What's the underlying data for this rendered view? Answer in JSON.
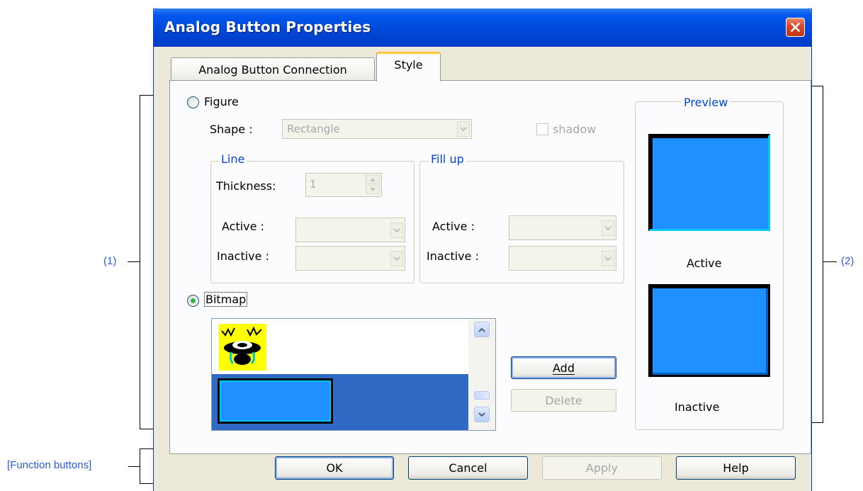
{
  "window": {
    "title": "Analog Button Properties",
    "close_icon": "close-icon"
  },
  "tabs": [
    {
      "label": "Analog Button Connection",
      "selected": false
    },
    {
      "label": "Style",
      "selected": true
    }
  ],
  "style": {
    "figure": {
      "label": "Figure",
      "selected": false
    },
    "shape": {
      "label": "Shape :",
      "value": "Rectangle"
    },
    "shadow": {
      "label": "shadow",
      "checked": false
    },
    "line": {
      "title": "Line",
      "thickness_label": "Thickness:",
      "thickness_value": "1",
      "active_label": "Active :",
      "inactive_label": "Inactive :"
    },
    "fill": {
      "title": "Fill up",
      "active_label": "Active :",
      "inactive_label": "Inactive :"
    },
    "bitmap": {
      "label": "Bitmap",
      "selected": true
    },
    "add_label": "Add",
    "delete_label": "Delete"
  },
  "preview": {
    "title": "Preview",
    "active_label": "Active",
    "inactive_label": "Inactive",
    "colors": {
      "fill": "#1e90ff",
      "frame": "#000000",
      "highlight": "#00c8ff"
    }
  },
  "buttons": {
    "ok": "OK",
    "cancel": "Cancel",
    "apply": "Apply",
    "help": "Help"
  },
  "annotations": {
    "left": "(1)",
    "right": "(2)",
    "function_buttons": "[Function buttons]"
  }
}
